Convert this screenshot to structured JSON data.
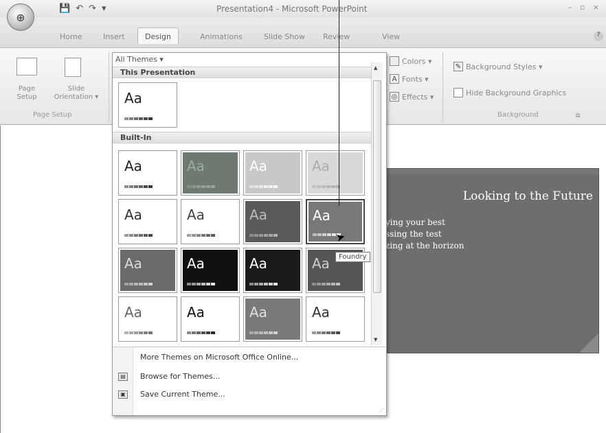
{
  "window": {
    "title": "Presentation4 - Microsoft PowerPoint",
    "office_button_icon": "office-logo-icon",
    "controls": "– ▫ ×"
  },
  "qat": {
    "save": "💾",
    "undo": "↶",
    "redo": "↷",
    "more": "▾"
  },
  "tabs": [
    "Home",
    "Insert",
    "Design",
    "Animations",
    "Slide Show",
    "Review",
    "View"
  ],
  "active_tab": "Design",
  "ribbon": {
    "page_setup": {
      "page_setup_label": "Page\nSetup",
      "orientation_label": "Slide\nOrientation ▾",
      "group_label": "Page Setup"
    },
    "themes_side": {
      "colors": "Colors ▾",
      "fonts": "Fonts ▾",
      "effects": "Effects ▾"
    },
    "background": {
      "styles": "Background Styles ▾",
      "hide_graphics": "Hide Background Graphics",
      "group_label": "Background"
    }
  },
  "gallery": {
    "header": "All Themes ▾",
    "this_presentation": "This Presentation",
    "built_in": "Built-In",
    "themes_current": [
      {
        "aa": "Aa",
        "bg": "#ffffff",
        "fg": "#222222"
      }
    ],
    "themes_builtin": [
      {
        "aa": "Aa",
        "bg": "#ffffff",
        "fg": "#222222"
      },
      {
        "aa": "Aa",
        "bg": "#6e7a70",
        "fg": "#9ab0a0"
      },
      {
        "aa": "Aa",
        "bg": "#c8c8c8",
        "fg": "#ffffff"
      },
      {
        "aa": "Aa",
        "bg": "#d8d8d8",
        "fg": "#aaaaaa"
      },
      {
        "aa": "Aa",
        "bg": "#ffffff",
        "fg": "#333333"
      },
      {
        "aa": "Aa",
        "bg": "#ffffff",
        "fg": "#444444"
      },
      {
        "aa": "Aa",
        "bg": "#5a5a5a",
        "fg": "#bbbbbb"
      },
      {
        "aa": "Aa",
        "bg": "#787878",
        "fg": "#ffffff"
      },
      {
        "aa": "Aa",
        "bg": "#6a6a6a",
        "fg": "#dddddd"
      },
      {
        "aa": "Aa",
        "bg": "#111111",
        "fg": "#ffffff"
      },
      {
        "aa": "Aa",
        "bg": "#1a1a1a",
        "fg": "#ffffff"
      },
      {
        "aa": "Aa",
        "bg": "#555555",
        "fg": "#cccccc"
      },
      {
        "aa": "Aa",
        "bg": "#ffffff",
        "fg": "#666666"
      },
      {
        "aa": "Aa",
        "bg": "#ffffff",
        "fg": "#111111"
      },
      {
        "aa": "Aa",
        "bg": "#7a7a7a",
        "fg": "#dddddd"
      },
      {
        "aa": "Aa",
        "bg": "#ffffff",
        "fg": "#333333"
      }
    ],
    "menu": {
      "more_themes": "More Themes on Microsoft Office Online...",
      "browse": "Browse for Themes...",
      "save": "Save Current Theme..."
    },
    "tooltip": "Foundry"
  },
  "slide": {
    "title": "Looking to the Future",
    "bullets": [
      "ying your best",
      "ssing the test",
      "zing at the horizon"
    ]
  }
}
